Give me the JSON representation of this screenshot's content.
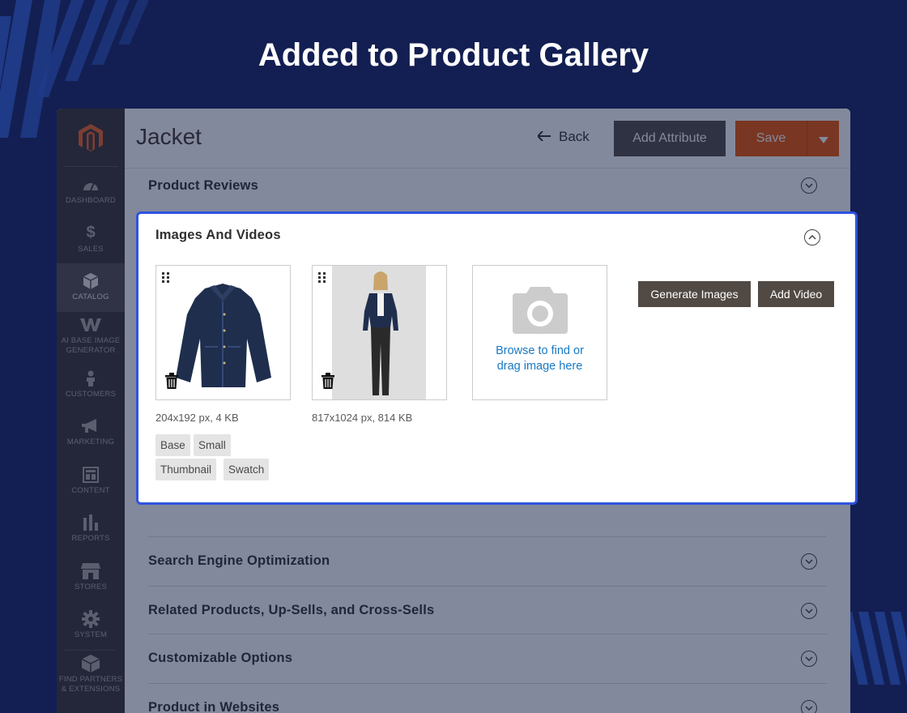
{
  "headline": "Added to Product Gallery",
  "colors": {
    "background": "#131f52",
    "accent_border": "#2f53e0",
    "save": "#eb5202",
    "dark_button": "#514943",
    "link": "#1979c3"
  },
  "sidebar": {
    "logo": "magento-logo-icon",
    "items": [
      {
        "label": "DASHBOARD",
        "icon": "dashboard-icon"
      },
      {
        "label": "SALES",
        "icon": "dollar-icon"
      },
      {
        "label": "CATALOG",
        "icon": "box-icon",
        "active": true
      },
      {
        "label": "AI BASE IMAGE GENERATOR",
        "icon": "ai-w-icon"
      },
      {
        "label": "CUSTOMERS",
        "icon": "person-icon"
      },
      {
        "label": "MARKETING",
        "icon": "megaphone-icon"
      },
      {
        "label": "CONTENT",
        "icon": "layout-icon"
      },
      {
        "label": "REPORTS",
        "icon": "bar-chart-icon"
      },
      {
        "label": "STORES",
        "icon": "store-icon"
      },
      {
        "label": "SYSTEM",
        "icon": "gear-icon"
      },
      {
        "label": "FIND PARTNERS & EXTENSIONS",
        "icon": "cube-icon"
      }
    ]
  },
  "header": {
    "title": "Jacket",
    "back_label": "Back",
    "add_attribute_label": "Add Attribute",
    "save_label": "Save"
  },
  "sections": {
    "product_reviews": "Product Reviews",
    "seo": "Search Engine Optimization",
    "related": "Related Products, Up-Sells, and Cross-Sells",
    "custom_options": "Customizable Options",
    "websites": "Product in Websites"
  },
  "images_and_videos": {
    "title": "Images And Videos",
    "images": [
      {
        "alt": "Denim jacket",
        "info": "204x192 px, 4 KB"
      },
      {
        "alt": "Model wearing denim jacket",
        "info": "817x1024 px, 814 KB"
      }
    ],
    "roles": [
      "Base",
      "Small",
      "Thumbnail",
      "Swatch"
    ],
    "upload_text_line1": "Browse to find or",
    "upload_text_line2": "drag image here",
    "generate_images_label": "Generate Images",
    "add_video_label": "Add Video"
  }
}
